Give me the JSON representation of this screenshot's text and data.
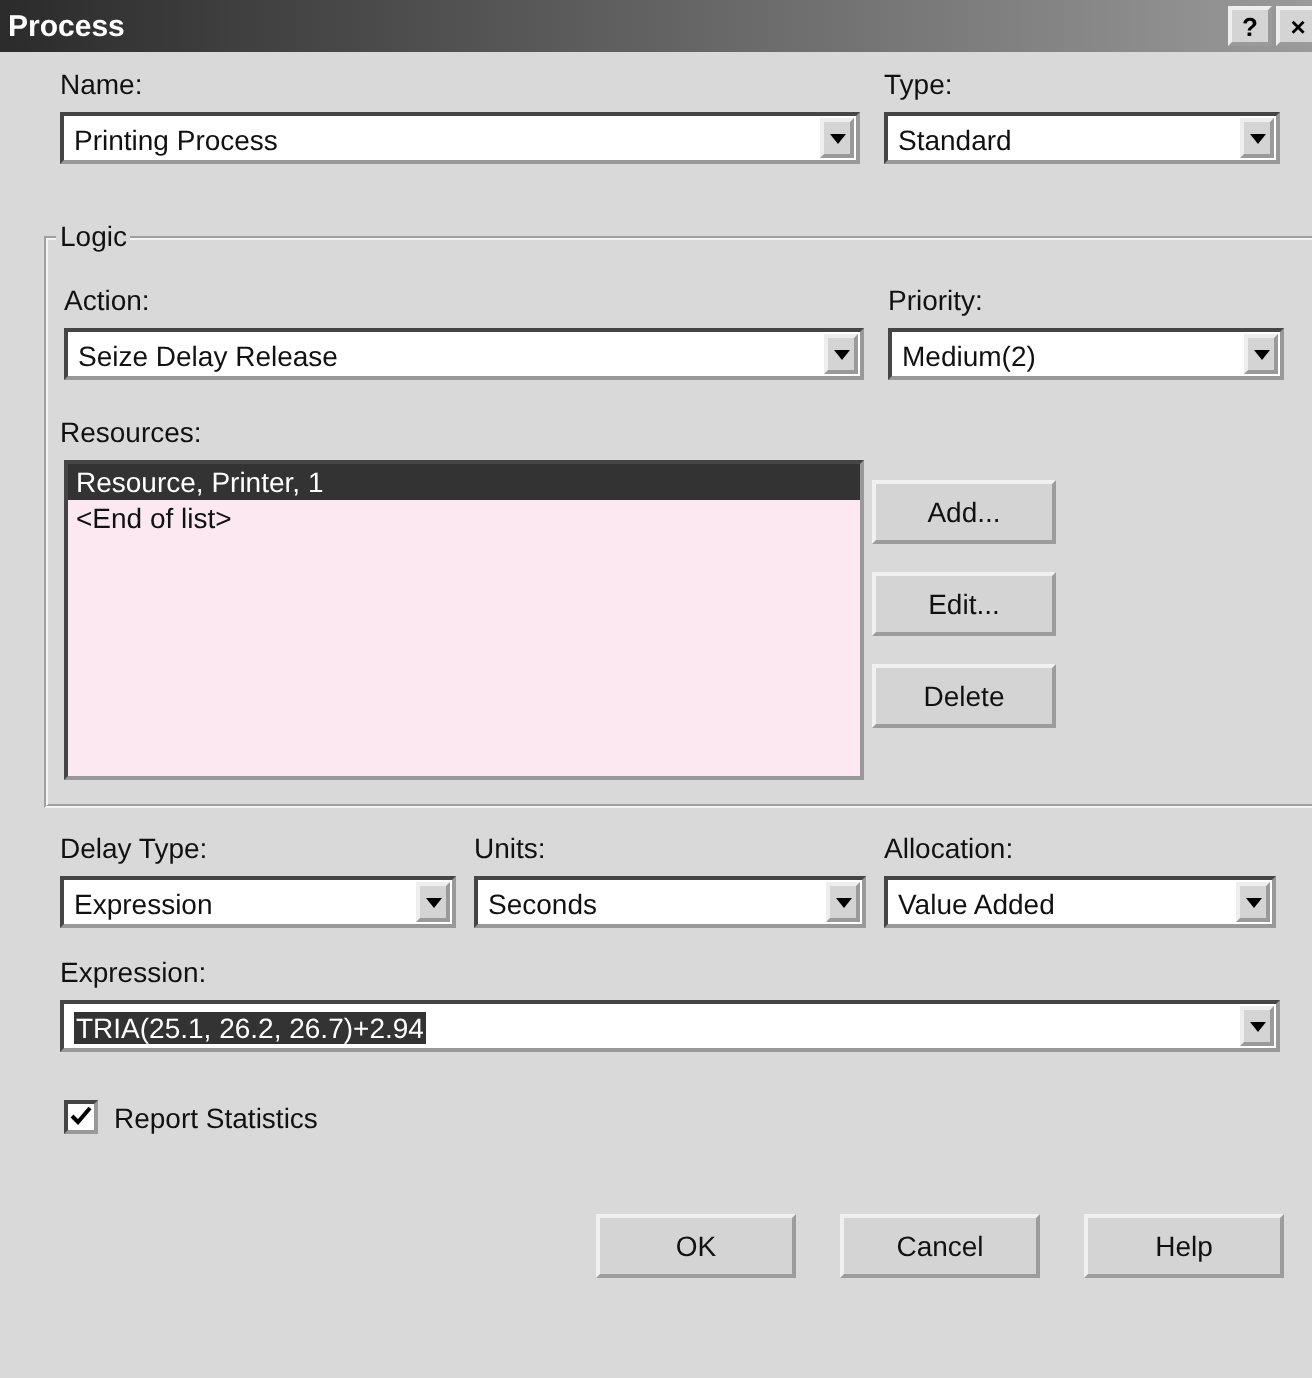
{
  "window": {
    "title": "Process",
    "help_button": "?",
    "close_button": "×"
  },
  "name": {
    "label": "Name:",
    "value": "Printing Process"
  },
  "type": {
    "label": "Type:",
    "value": "Standard"
  },
  "logic": {
    "title": "Logic",
    "action": {
      "label": "Action:",
      "value": "Seize Delay Release"
    },
    "priority": {
      "label": "Priority:",
      "value": "Medium(2)"
    },
    "resources": {
      "label": "Resources:",
      "items": [
        {
          "text": "Resource, Printer, 1",
          "selected": true
        },
        {
          "text": "<End of list>",
          "selected": false
        }
      ]
    },
    "buttons": [
      "Add...",
      "Edit...",
      "Delete"
    ]
  },
  "delay_type": {
    "label": "Delay Type:",
    "value": "Expression"
  },
  "units": {
    "label": "Units:",
    "value": "Seconds"
  },
  "allocation": {
    "label": "Allocation:",
    "value": "Value Added"
  },
  "expression": {
    "label": "Expression:",
    "value": "TRIA(25.1, 26.2, 26.7)+2.94"
  },
  "report_statistics": {
    "label": "Report Statistics",
    "checked": true
  },
  "buttons": [
    "OK",
    "Cancel",
    "Help"
  ]
}
